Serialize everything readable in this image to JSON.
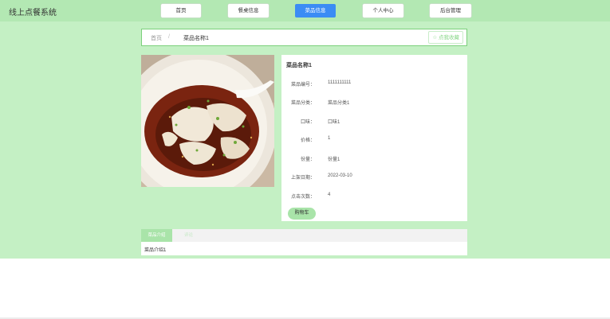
{
  "app": {
    "title": "线上点餐系统"
  },
  "nav": {
    "items": [
      {
        "label": "首页"
      },
      {
        "label": "餐桌信息"
      },
      {
        "label": "菜品信息"
      },
      {
        "label": "个人中心"
      },
      {
        "label": "后台管理"
      }
    ],
    "active_index": 2
  },
  "breadcrumb": {
    "home": "首页",
    "separator": "/",
    "current": "菜品名称1",
    "favorite_label": "☆ 点我收藏"
  },
  "dish": {
    "name": "菜品名称1",
    "fields": [
      {
        "label": "菜品编号：",
        "value": "1111111111"
      },
      {
        "label": "菜品分类：",
        "value": "菜品分类1"
      },
      {
        "label": "口味：",
        "value": "口味1"
      },
      {
        "label": "价格：",
        "value": "1"
      },
      {
        "label": "份量：",
        "value": "份量1"
      },
      {
        "label": "上架日期：",
        "value": "2022-03-10"
      },
      {
        "label": "点击次数：",
        "value": "4"
      }
    ],
    "cart_label": "购物车"
  },
  "tabs": {
    "items": [
      {
        "label": "菜品介绍"
      },
      {
        "label": "评论"
      }
    ],
    "active_index": 0,
    "content": "菜品介绍1"
  },
  "colors": {
    "background": "#c4f0c4",
    "topbar": "#b3e8b3",
    "active_nav": "#3b8cf4",
    "accent_green": "#a9e4a9"
  }
}
